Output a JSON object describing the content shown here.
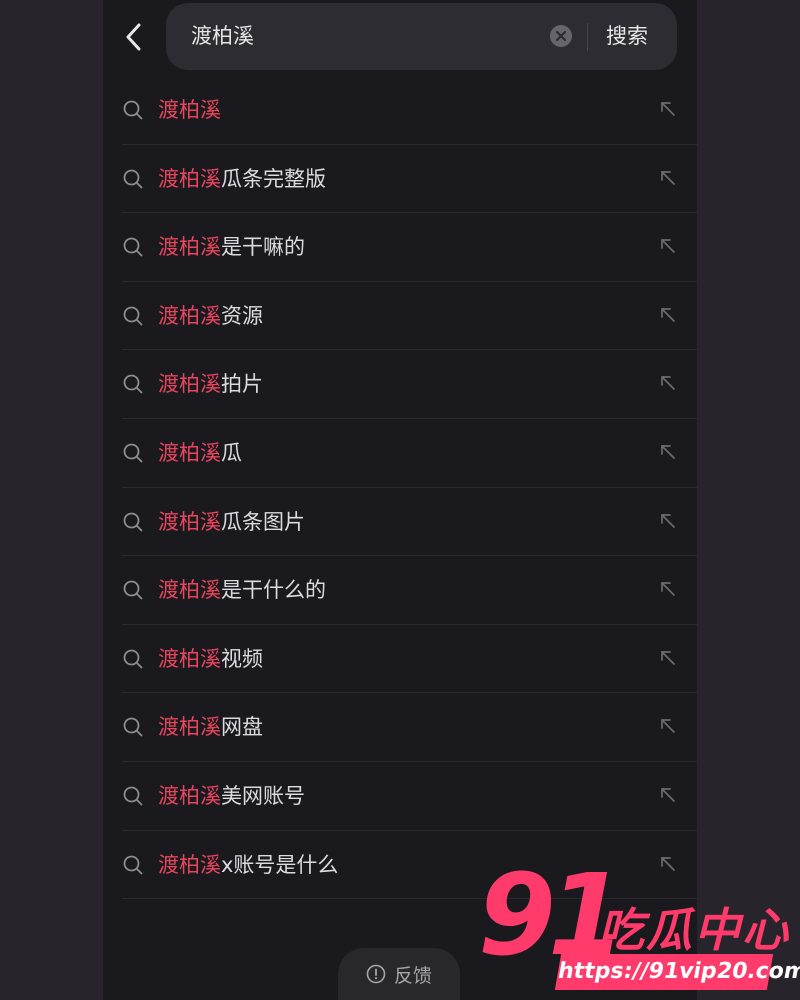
{
  "search": {
    "query": "渡柏溪",
    "submit_label": "搜索"
  },
  "suggestions": [
    {
      "highlight": "渡柏溪",
      "rest": ""
    },
    {
      "highlight": "渡柏溪",
      "rest": "瓜条完整版"
    },
    {
      "highlight": "渡柏溪",
      "rest": "是干嘛的"
    },
    {
      "highlight": "渡柏溪",
      "rest": "资源"
    },
    {
      "highlight": "渡柏溪",
      "rest": "拍片"
    },
    {
      "highlight": "渡柏溪",
      "rest": "瓜"
    },
    {
      "highlight": "渡柏溪",
      "rest": "瓜条图片"
    },
    {
      "highlight": "渡柏溪",
      "rest": "是干什么的"
    },
    {
      "highlight": "渡柏溪",
      "rest": "视频"
    },
    {
      "highlight": "渡柏溪",
      "rest": "网盘"
    },
    {
      "highlight": "渡柏溪",
      "rest": "美网账号"
    },
    {
      "highlight": "渡柏溪",
      "rest": "x账号是什么"
    }
  ],
  "feedback_label": "反馈",
  "watermark": {
    "number": "91",
    "name": "吃瓜中心",
    "url": "https://91vip20.com"
  },
  "colors": {
    "highlight": "#e8455e",
    "background": "#1a191e",
    "watermark": "#ff3b6b"
  },
  "icons": [
    "back-arrow-icon",
    "clear-icon",
    "search-icon",
    "fill-arrow-icon",
    "info-icon"
  ]
}
